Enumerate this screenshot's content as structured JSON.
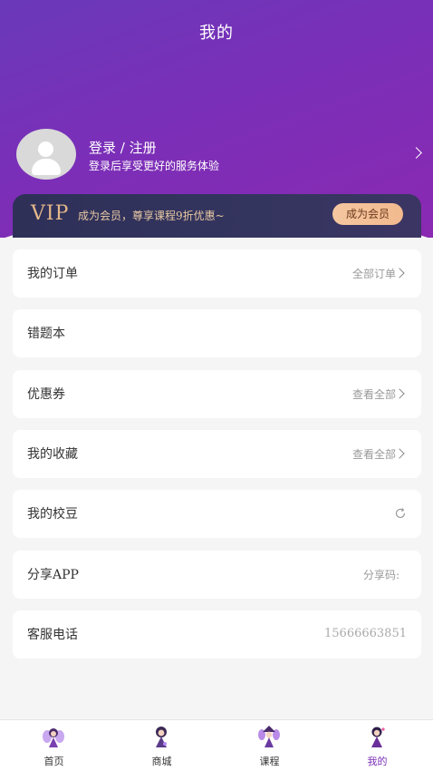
{
  "header": {
    "title": "我的"
  },
  "profile": {
    "login_title": "登录 / 注册",
    "login_subtitle": "登录后享受更好的服务体验"
  },
  "vip": {
    "logo": "VIP",
    "text": "成为会员，尊享课程9折优惠~",
    "button": "成为会员"
  },
  "menu": [
    {
      "label": "我的订单",
      "right": "全部订单"
    },
    {
      "label": "错题本",
      "right": ""
    },
    {
      "label": "优惠券",
      "right": "查看全部"
    },
    {
      "label": "我的收藏",
      "right": "查看全部"
    },
    {
      "label": "我的校豆",
      "right": ""
    },
    {
      "label": "分享APP",
      "right": "分享码:"
    },
    {
      "label": "客服电话",
      "right": "15666663851"
    }
  ],
  "tabs": [
    {
      "label": "首页",
      "icon": "fairy-icon"
    },
    {
      "label": "商城",
      "icon": "fairy-icon"
    },
    {
      "label": "课程",
      "icon": "fairy-icon"
    },
    {
      "label": "我的",
      "icon": "fairy-icon"
    }
  ],
  "colors": {
    "header_purple": "#7a2fb8",
    "vip_gold": "#e5b88a",
    "vip_button": "#f2b98e",
    "active_tab": "#7a2fb8"
  }
}
